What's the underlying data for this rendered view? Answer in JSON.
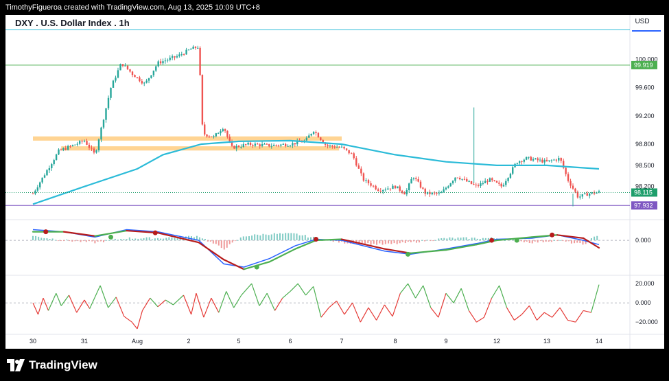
{
  "header": {
    "attribution": "TimothyFigueroa created with TradingView.com, Aug 13, 2025 10:09 UTC+8",
    "symbol_title": "DXY . U.S. Dollar Index . 1h",
    "currency": "USD"
  },
  "footer": {
    "brand": "TradingView"
  },
  "colors": {
    "up": "#26a69a",
    "down": "#ef5350",
    "ma": "#2bbbd8",
    "macd_line": "#2962ff",
    "signal_line": "#b71c1c",
    "signal_up": "#4caf50",
    "zone": "#ffcc80",
    "line_99919": "#4caf50",
    "line_97932": "#7e57c2",
    "current_price": "#1e9e6b",
    "rsi_up": "#4caf50",
    "rsi_down": "#e53935"
  },
  "chart_data": {
    "type": "candlestick",
    "x_axis_labels": [
      "30",
      "31",
      "Aug",
      "2",
      "5",
      "6",
      "7",
      "8",
      "9",
      "12",
      "13",
      "14"
    ],
    "price_axis": {
      "ticks": [
        {
          "label": "100.000",
          "value": 100.0
        },
        {
          "label": "99.600",
          "value": 99.6
        },
        {
          "label": "99.200",
          "value": 99.2
        },
        {
          "label": "98.800",
          "value": 98.8
        },
        {
          "label": "98.500",
          "value": 98.5
        },
        {
          "label": "98.200",
          "value": 98.2
        }
      ],
      "range": [
        97.75,
        100.55
      ]
    },
    "price_labels": [
      {
        "label": "99.919",
        "value": 99.919,
        "color": "#4caf50"
      },
      {
        "label": "98.115",
        "value": 98.115,
        "color": "#1e9e6b"
      },
      {
        "label": "97.932",
        "value": 97.932,
        "color": "#7e57c2"
      }
    ],
    "horizontal_lines": [
      {
        "value": 100.42,
        "color": "#2bbbd8"
      },
      {
        "value": 99.919,
        "color": "#4caf50"
      },
      {
        "value": 97.932,
        "color": "#7e57c2"
      }
    ],
    "zones": [
      {
        "from_day": 0.0,
        "to_day": 6.0,
        "low": 98.85,
        "high": 98.91
      },
      {
        "from_day": 0.55,
        "to_day": 5.95,
        "low": 98.71,
        "high": 98.77
      }
    ],
    "trend_path": [
      [
        0.0,
        98.1
      ],
      [
        0.5,
        98.7
      ],
      [
        1.0,
        98.85
      ],
      [
        1.2,
        98.65
      ],
      [
        1.5,
        99.6
      ],
      [
        1.7,
        99.95
      ],
      [
        1.9,
        99.8
      ],
      [
        2.15,
        99.65
      ],
      [
        2.4,
        99.95
      ],
      [
        2.8,
        100.05
      ],
      [
        3.05,
        100.15
      ],
      [
        3.2,
        100.18
      ],
      [
        3.28,
        98.95
      ],
      [
        3.5,
        98.9
      ],
      [
        3.7,
        99.05
      ],
      [
        3.85,
        98.75
      ],
      [
        4.2,
        98.8
      ],
      [
        4.6,
        98.78
      ],
      [
        5.0,
        98.8
      ],
      [
        5.3,
        98.85
      ],
      [
        5.45,
        99.0
      ],
      [
        5.7,
        98.78
      ],
      [
        6.0,
        98.75
      ],
      [
        6.2,
        98.65
      ],
      [
        6.4,
        98.3
      ],
      [
        6.7,
        98.15
      ],
      [
        7.0,
        98.2
      ],
      [
        7.2,
        98.1
      ],
      [
        7.35,
        98.35
      ],
      [
        7.6,
        98.1
      ],
      [
        7.9,
        98.1
      ],
      [
        8.2,
        98.35
      ],
      [
        8.6,
        98.2
      ],
      [
        8.85,
        98.3
      ],
      [
        9.1,
        98.2
      ],
      [
        9.4,
        98.55
      ],
      [
        9.6,
        98.6
      ],
      [
        10.0,
        98.55
      ],
      [
        10.25,
        98.6
      ],
      [
        10.4,
        98.3
      ],
      [
        10.6,
        98.05
      ],
      [
        10.8,
        98.1
      ],
      [
        11.0,
        98.12
      ]
    ],
    "wick_spikes": [
      {
        "day": 8.55,
        "low": 98.25,
        "high": 99.32
      },
      {
        "day": 10.5,
        "low": 97.92,
        "high": 98.1
      }
    ],
    "moving_average": [
      [
        0.0,
        97.95
      ],
      [
        1.0,
        98.2
      ],
      [
        2.0,
        98.45
      ],
      [
        2.5,
        98.65
      ],
      [
        3.25,
        98.8
      ],
      [
        4.0,
        98.84
      ],
      [
        5.0,
        98.85
      ],
      [
        6.0,
        98.8
      ],
      [
        7.0,
        98.65
      ],
      [
        8.0,
        98.55
      ],
      [
        9.0,
        98.5
      ],
      [
        10.0,
        98.5
      ],
      [
        11.0,
        98.45
      ]
    ],
    "macd": {
      "zero_label": "0.000",
      "range": [
        -0.32,
        0.18
      ],
      "macd_line": [
        [
          0.0,
          0.1
        ],
        [
          0.6,
          0.08
        ],
        [
          1.2,
          0.03
        ],
        [
          1.8,
          0.1
        ],
        [
          2.4,
          0.08
        ],
        [
          3.2,
          0.0
        ],
        [
          3.7,
          -0.22
        ],
        [
          4.1,
          -0.25
        ],
        [
          4.6,
          -0.17
        ],
        [
          5.1,
          -0.05
        ],
        [
          5.5,
          0.01
        ],
        [
          6.0,
          0.0
        ],
        [
          6.8,
          -0.1
        ],
        [
          7.3,
          -0.13
        ],
        [
          8.0,
          -0.08
        ],
        [
          8.6,
          -0.03
        ],
        [
          9.0,
          0.01
        ],
        [
          9.7,
          0.02
        ],
        [
          10.2,
          0.05
        ],
        [
          10.7,
          0.0
        ],
        [
          11.0,
          -0.04
        ]
      ],
      "signal_line": [
        [
          0.0,
          0.08
        ],
        [
          0.6,
          0.08
        ],
        [
          1.2,
          0.04
        ],
        [
          1.8,
          0.09
        ],
        [
          2.4,
          0.07
        ],
        [
          3.2,
          -0.02
        ],
        [
          3.7,
          -0.18
        ],
        [
          4.1,
          -0.27
        ],
        [
          4.6,
          -0.2
        ],
        [
          5.1,
          -0.08
        ],
        [
          5.5,
          0.0
        ],
        [
          6.0,
          0.01
        ],
        [
          6.8,
          -0.08
        ],
        [
          7.3,
          -0.12
        ],
        [
          8.0,
          -0.09
        ],
        [
          8.6,
          -0.04
        ],
        [
          9.0,
          0.0
        ],
        [
          9.7,
          0.03
        ],
        [
          10.2,
          0.05
        ],
        [
          10.7,
          0.02
        ],
        [
          11.0,
          -0.07
        ]
      ],
      "cross_markers": [
        {
          "day": 0.25,
          "value": 0.08,
          "kind": "bearish"
        },
        {
          "day": 1.5,
          "value": 0.03,
          "kind": "bullish"
        },
        {
          "day": 2.35,
          "value": 0.07,
          "kind": "bearish"
        },
        {
          "day": 4.35,
          "value": -0.25,
          "kind": "bullish"
        },
        {
          "day": 5.5,
          "value": 0.01,
          "kind": "bearish"
        },
        {
          "day": 7.25,
          "value": -0.13,
          "kind": "bullish"
        },
        {
          "day": 8.9,
          "value": 0.0,
          "kind": "bearish"
        },
        {
          "day": 9.4,
          "value": 0.0,
          "kind": "bullish"
        },
        {
          "day": 10.1,
          "value": 0.05,
          "kind": "bearish"
        }
      ]
    },
    "oscillator": {
      "ticks": [
        {
          "label": "20.000",
          "value": 20
        },
        {
          "label": "0.000",
          "value": 0
        },
        {
          "label": "−20.000",
          "value": -20
        }
      ],
      "range": [
        -32,
        28
      ],
      "points": [
        [
          0.0,
          0
        ],
        [
          0.1,
          -12
        ],
        [
          0.2,
          5
        ],
        [
          0.3,
          -8
        ],
        [
          0.45,
          10
        ],
        [
          0.55,
          -3
        ],
        [
          0.7,
          8
        ],
        [
          0.85,
          -10
        ],
        [
          1.0,
          3
        ],
        [
          1.1,
          -6
        ],
        [
          1.3,
          18
        ],
        [
          1.45,
          -5
        ],
        [
          1.6,
          6
        ],
        [
          1.75,
          -14
        ],
        [
          1.9,
          -20
        ],
        [
          2.0,
          -27
        ],
        [
          2.1,
          -8
        ],
        [
          2.25,
          5
        ],
        [
          2.4,
          -4
        ],
        [
          2.55,
          3
        ],
        [
          2.7,
          -2
        ],
        [
          2.9,
          8
        ],
        [
          3.05,
          -12
        ],
        [
          3.15,
          10
        ],
        [
          3.3,
          -15
        ],
        [
          3.45,
          5
        ],
        [
          3.6,
          -10
        ],
        [
          3.75,
          12
        ],
        [
          3.9,
          -5
        ],
        [
          4.05,
          8
        ],
        [
          4.25,
          20
        ],
        [
          4.4,
          -3
        ],
        [
          4.55,
          10
        ],
        [
          4.7,
          -8
        ],
        [
          4.85,
          5
        ],
        [
          5.0,
          12
        ],
        [
          5.15,
          20
        ],
        [
          5.3,
          8
        ],
        [
          5.45,
          17
        ],
        [
          5.6,
          -15
        ],
        [
          5.75,
          -5
        ],
        [
          5.9,
          2
        ],
        [
          6.05,
          -12
        ],
        [
          6.2,
          0
        ],
        [
          6.35,
          -20
        ],
        [
          6.5,
          -5
        ],
        [
          6.65,
          -18
        ],
        [
          6.8,
          -2
        ],
        [
          6.95,
          -14
        ],
        [
          7.1,
          10
        ],
        [
          7.25,
          20
        ],
        [
          7.4,
          5
        ],
        [
          7.55,
          18
        ],
        [
          7.7,
          -5
        ],
        [
          7.85,
          -15
        ],
        [
          8.0,
          10
        ],
        [
          8.15,
          0
        ],
        [
          8.3,
          15
        ],
        [
          8.45,
          -8
        ],
        [
          8.6,
          -20
        ],
        [
          8.75,
          -15
        ],
        [
          8.9,
          5
        ],
        [
          9.05,
          18
        ],
        [
          9.2,
          -5
        ],
        [
          9.35,
          -18
        ],
        [
          9.5,
          -12
        ],
        [
          9.65,
          -3
        ],
        [
          9.8,
          -18
        ],
        [
          9.95,
          -10
        ],
        [
          10.1,
          -15
        ],
        [
          10.25,
          -5
        ],
        [
          10.4,
          -18
        ],
        [
          10.55,
          -20
        ],
        [
          10.7,
          -8
        ],
        [
          10.85,
          -10
        ],
        [
          11.0,
          19
        ]
      ]
    }
  }
}
